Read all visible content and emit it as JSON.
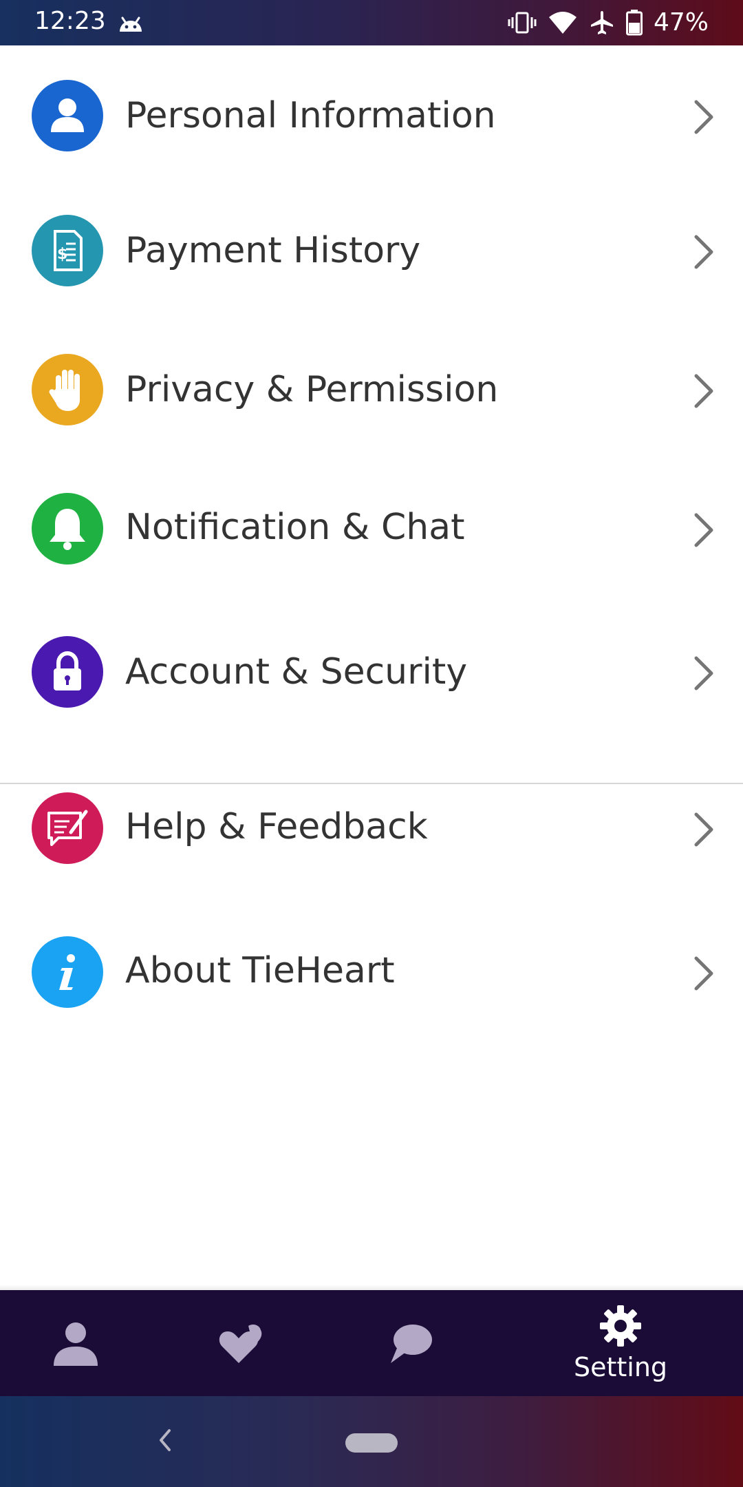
{
  "status_bar": {
    "time": "12:23",
    "battery": "47%",
    "icons": [
      "android-icon",
      "vibrate-icon",
      "wifi-icon",
      "airplane-icon",
      "battery-icon"
    ]
  },
  "settings": {
    "items": [
      {
        "label": "Personal Information",
        "icon": "person-icon",
        "color": "#1a66d0"
      },
      {
        "label": "Payment History",
        "icon": "receipt-icon",
        "color": "#2596b0"
      },
      {
        "label": "Privacy & Permission",
        "icon": "hand-icon",
        "color": "#eaa720"
      },
      {
        "label": "Notification & Chat",
        "icon": "bell-icon",
        "color": "#1fb243"
      },
      {
        "label": "Account & Security",
        "icon": "lock-icon",
        "color": "#4a19b0"
      },
      {
        "label": "Help & Feedback",
        "icon": "feedback-icon",
        "color": "#cf1c58"
      },
      {
        "label": "About TieHeart",
        "icon": "info-icon",
        "color": "#1aa3f2"
      }
    ]
  },
  "bottom_nav": {
    "items": [
      {
        "name": "profile",
        "icon": "person-icon",
        "label": ""
      },
      {
        "name": "matches",
        "icon": "hearts-icon",
        "label": ""
      },
      {
        "name": "chat",
        "icon": "chat-icon",
        "label": ""
      },
      {
        "name": "setting",
        "icon": "gear-icon",
        "label": "Setting"
      }
    ]
  },
  "colors": {
    "chevron": "#757575",
    "text": "#333333",
    "nav_background": "#1a0c36",
    "nav_inactive_icon": "#b3a9c6"
  }
}
